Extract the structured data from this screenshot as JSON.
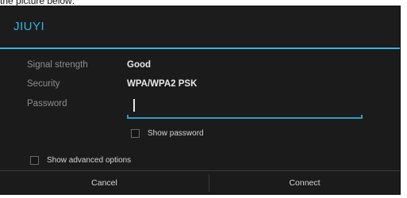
{
  "page": {
    "caption": "the picture below:"
  },
  "dialog": {
    "title": "JIUYI",
    "accent_color": "#33b5e5",
    "rows": [
      {
        "label": "Signal strength",
        "value": "Good"
      },
      {
        "label": "Security",
        "value": "WPA/WPA2 PSK"
      }
    ],
    "password": {
      "label": "Password",
      "value": "",
      "placeholder": ""
    },
    "show_password": {
      "label": "Show password",
      "checked": false
    },
    "show_advanced": {
      "label": "Show advanced options",
      "checked": false
    },
    "buttons": {
      "cancel": "Cancel",
      "connect": "Connect"
    }
  }
}
